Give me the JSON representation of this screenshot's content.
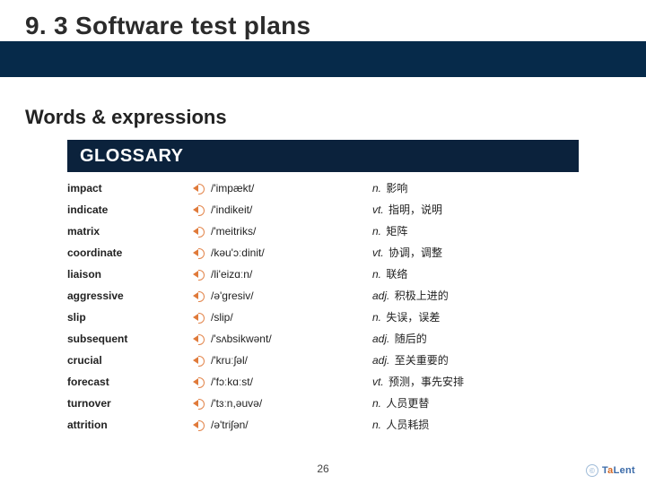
{
  "header": {
    "title": "9. 3 Software test plans",
    "subtitle": "Words & expressions"
  },
  "glossary": {
    "heading": "GLOSSARY",
    "rows": [
      {
        "term": "impact",
        "ipa": "/'impækt/",
        "pos": "n.",
        "def": "影响"
      },
      {
        "term": "indicate",
        "ipa": "/'indikeit/",
        "pos": "vt.",
        "def": "指明，说明"
      },
      {
        "term": "matrix",
        "ipa": "/'meitriks/",
        "pos": "n.",
        "def": "矩阵"
      },
      {
        "term": "coordinate",
        "ipa": "/kəu'ɔːdinit/",
        "pos": "vt.",
        "def": "协调，调整"
      },
      {
        "term": "liaison",
        "ipa": "/li'eizɑːn/",
        "pos": "n.",
        "def": "联络"
      },
      {
        "term": "aggressive",
        "ipa": "/ə'gresiv/",
        "pos": "adj.",
        "def": "积极上进的"
      },
      {
        "term": "slip",
        "ipa": "/slip/",
        "pos": "n.",
        "def": "失误，误差"
      },
      {
        "term": "subsequent",
        "ipa": "/'sʌbsikwənt/",
        "pos": "adj.",
        "def": "随后的"
      },
      {
        "term": "crucial",
        "ipa": "/'kruːʃəl/",
        "pos": "adj.",
        "def": "至关重要的"
      },
      {
        "term": "forecast",
        "ipa": "/'fɔːkɑːst/",
        "pos": "vt.",
        "def": "预测，事先安排"
      },
      {
        "term": "turnover",
        "ipa": "/'tɜːn,əuvə/",
        "pos": "n.",
        "def": "人员更替"
      },
      {
        "term": "attrition",
        "ipa": "/ə'triʃən/",
        "pos": "n.",
        "def": "人员耗损"
      }
    ]
  },
  "footer": {
    "page": "26",
    "brand_parts": {
      "t1": "T",
      "a": "a",
      "lent": "Lent"
    }
  }
}
